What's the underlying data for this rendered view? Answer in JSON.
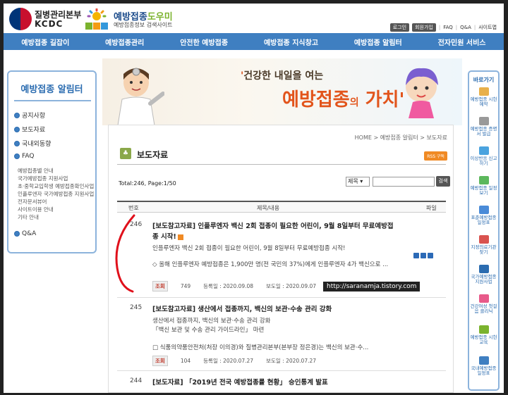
{
  "header": {
    "kcdc_title": "질병관리본부",
    "kcdc_sub": "KCDC",
    "site_title_a": "예방접종",
    "site_title_b": "도우미",
    "site_sub": "예방접종정보 검색사이트",
    "links": [
      "로그인",
      "회원가입",
      "FAQ",
      "Q&A",
      "사이트맵"
    ]
  },
  "nav": {
    "items": [
      "예방접종 길잡이",
      "예방접종관리",
      "안전한 예방접종",
      "예방접종 지식창고",
      "예방접종 알림터",
      "전자민원 서비스"
    ]
  },
  "leftnav": {
    "title": "예방접종 알림터",
    "items": [
      "공지사항",
      "보도자료",
      "국내외동향",
      "FAQ"
    ],
    "subs": [
      "예방접종별 안내",
      "국가예방접종 지원사업",
      "초·중학교입학생 예방접종확인사업",
      "인플루엔자 국가예방접종 지원사업",
      "전자문서뷰어",
      "사이트이용 안내",
      "기타 안내"
    ],
    "qa": "Q&A"
  },
  "banner": {
    "line1_a": "건강한 내일을 여는",
    "line2_a": "예방접종",
    "line2_b": "의",
    "line2_c": "가치"
  },
  "content": {
    "breadcrumb": "HOME > 예방접종 알림터 > 보도자료",
    "title": "보도자료",
    "rss": "RSS 구독",
    "total": "Total:246, Page:1/50",
    "search_select": "제목",
    "search_button": "검색",
    "col_num": "번호",
    "col_title": "제목/내용",
    "col_file": "파일",
    "rows": [
      {
        "num": "246",
        "title": "[보도참고자료] 인플루엔자 백신 2회 접종이 필요한 어린이, 9월 8일부터 무료예방접종 시작!",
        "summary1": "인플루엔자 백신 2회 접종이 필요한 어린이, 9월 8일부터 무료예방접종 시작!",
        "summary2": "◇ 올해 인플루엔자 예방접종은 1,900만 명(전 국민의 37%)에게 인플루엔자 4가 백신으로 ...",
        "hits_label": "조회",
        "hits": "749",
        "reg": "등록일 : 2020.09.08",
        "pub": "보도일 : 2020.09.07"
      },
      {
        "num": "245",
        "title": "[보도참고자료] 생산에서 접종까지, 백신의 보관·수송 관리 강화",
        "summary1": "생산에서 접종까지, 백신의 보관·수송 관리 강화",
        "summary1b": "「백신 보관 및 수송 관리 가이드라인」 마련",
        "summary2": "□ 식품의약품안전처(처장 이의경)와 질병관리본부(본부장 정은경)는 백신의 보관·수...",
        "hits_label": "조회",
        "hits": "104",
        "reg": "등록일 : 2020.07.27",
        "pub": "보도일 : 2020.07.27"
      },
      {
        "num": "244",
        "title": "[보도자료] 「2019년 전국 예방접종률 현황」 승인통계 발표"
      }
    ]
  },
  "quick": {
    "head": "바로가기",
    "items": [
      "예방접종 시헌예약",
      "예방접종 증명서 발급",
      "이상반응 신고하기",
      "예방접종 일정보기",
      "표준예방접종 일정표",
      "지정의료기관 찾기",
      "국가예방접종 지원사업",
      "건강여성 첫걸음 클리닉",
      "예방접종 시헌교육",
      "국내예방접종 일정표"
    ]
  },
  "watermark": "http://saranamja.tistory.com",
  "colors": {
    "nav": "#3f7fc1",
    "accent": "#e2541b",
    "annotation": "#e0101b"
  }
}
